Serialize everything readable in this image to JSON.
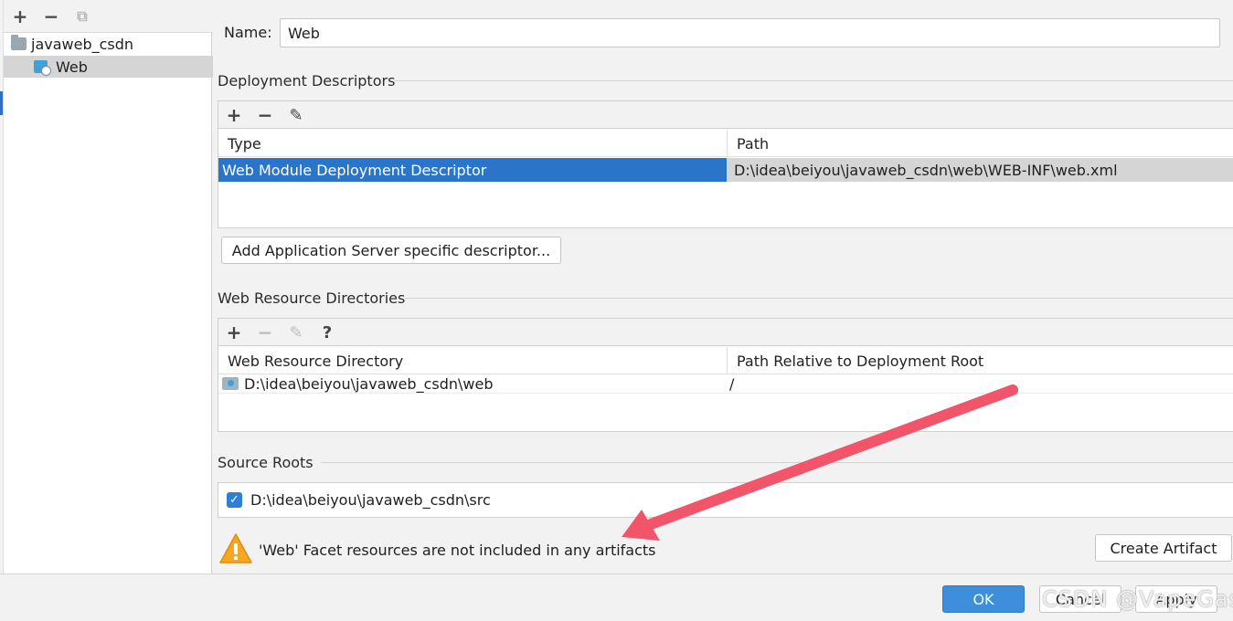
{
  "left_panel": {
    "toolbar": {
      "add": "+",
      "remove": "−",
      "copy": "⧉"
    },
    "tree": [
      {
        "label": "javaweb_csdn",
        "icon": "module-folder-icon"
      },
      {
        "label": "Web",
        "icon": "web-facet-icon"
      }
    ]
  },
  "name_field": {
    "label": "Name:",
    "value": "Web"
  },
  "deployment_descriptors": {
    "title": "Deployment Descriptors",
    "toolbar": {
      "add": "+",
      "remove": "−",
      "edit": "✎"
    },
    "columns": [
      "Type",
      "Path"
    ],
    "rows": [
      {
        "type": "Web Module Deployment Descriptor",
        "path": "D:\\idea\\beiyou\\javaweb_csdn\\web\\WEB-INF\\web.xml"
      }
    ],
    "add_button": "Add Application Server specific descriptor..."
  },
  "web_resource_directories": {
    "title": "Web Resource Directories",
    "toolbar": {
      "add": "+",
      "remove": "−",
      "edit": "✎",
      "help": "?"
    },
    "columns": [
      "Web Resource Directory",
      "Path Relative to Deployment Root"
    ],
    "rows": [
      {
        "directory": "D:\\idea\\beiyou\\javaweb_csdn\\web",
        "relative": "/"
      }
    ]
  },
  "source_roots": {
    "title": "Source Roots",
    "items": [
      {
        "path": "D:\\idea\\beiyou\\javaweb_csdn\\src",
        "checked": true
      }
    ]
  },
  "warning": {
    "text": "'Web' Facet resources are not included in any artifacts",
    "button": "Create Artifact"
  },
  "dialog_buttons": {
    "ok": "OK",
    "cancel": "Cancel",
    "apply": "Apply"
  },
  "watermark": "CSDN @VapeGas",
  "colors": {
    "selection": "#2a75c9",
    "primary_button": "#3d8fdc",
    "annotation_arrow": "#f2546a"
  }
}
